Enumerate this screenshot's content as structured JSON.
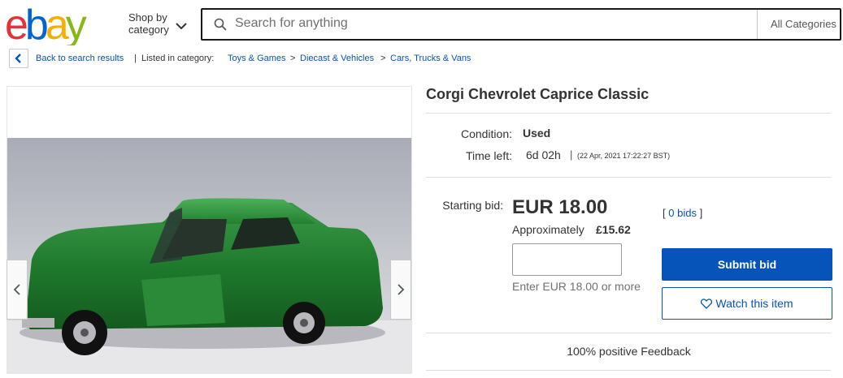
{
  "header": {
    "logo_text": "ebay",
    "shop_by_line1": "Shop by",
    "shop_by_line2": "category",
    "search_placeholder": "Search for anything",
    "category_select": "All Categories"
  },
  "breadcrumb": {
    "back_label": "Back to search results",
    "separator": "|",
    "listed_in": "Listed in category:",
    "items": [
      "Toys & Games",
      "Diecast & Vehicles",
      "Cars, Trucks & Vans"
    ],
    "arrow": ">"
  },
  "item": {
    "title": "Corgi Chevrolet Caprice Classic",
    "condition_label": "Condition:",
    "condition_value": "Used",
    "time_left_label": "Time left:",
    "time_left_value": "6d 02h",
    "time_separator": "|",
    "end_time": "(22 Apr, 2021  17:22:27 BST)"
  },
  "bidding": {
    "starting_bid_label": "Starting bid:",
    "price": "EUR 18.00",
    "approx_label": "Approximately",
    "approx_value": "£15.62",
    "bids_open": "[",
    "bids_count": "0 bids",
    "bids_close": "]",
    "input_value": "",
    "hint": "Enter EUR 18.00 or more",
    "submit_label": "Submit bid",
    "watch_label": "Watch this item"
  },
  "seller": {
    "feedback": "100% positive Feedback"
  },
  "colors": {
    "ebay_e": "#e53238",
    "ebay_b": "#0064d2",
    "ebay_a": "#f5af02",
    "ebay_y": "#86b817",
    "link": "#0654ba",
    "submit_bg": "#0654ba"
  },
  "icons": {
    "chevron": "chevron-down-icon",
    "search": "search-icon",
    "back": "chevron-left-icon",
    "prev": "chevron-left-icon",
    "next": "chevron-right-icon",
    "heart": "heart-icon"
  }
}
